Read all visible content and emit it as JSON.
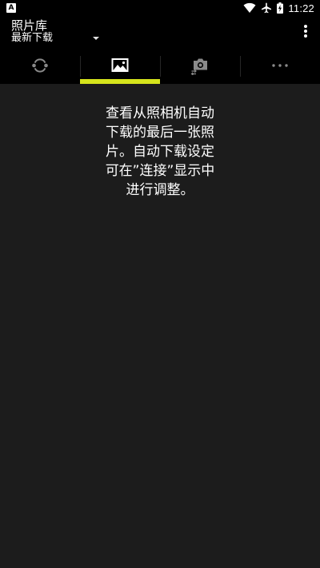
{
  "status_bar": {
    "app_icon_letter": "A",
    "time": "11:22",
    "icons": [
      "wifi-icon",
      "airplane-mode-icon",
      "battery-charging-icon"
    ]
  },
  "app_bar": {
    "title": "照片库",
    "filter": {
      "selected": "最新下载"
    },
    "overflow_icon": "more-vert-icon"
  },
  "tabs": [
    {
      "icon": "sync-icon",
      "selected": false
    },
    {
      "icon": "image-gallery-icon",
      "selected": true
    },
    {
      "icon": "camera-transfer-icon",
      "selected": false
    },
    {
      "icon": "more-horiz-icon",
      "selected": false
    }
  ],
  "colors": {
    "background": "#1c1c1c",
    "bars": "#000000",
    "accent": "#d6e41c",
    "inactive_icon": "#8a8a8a"
  },
  "content": {
    "message": "查看从照相机自动下载的最后一张照片。自动下载设定可在”连接”显示中进行调整。"
  }
}
